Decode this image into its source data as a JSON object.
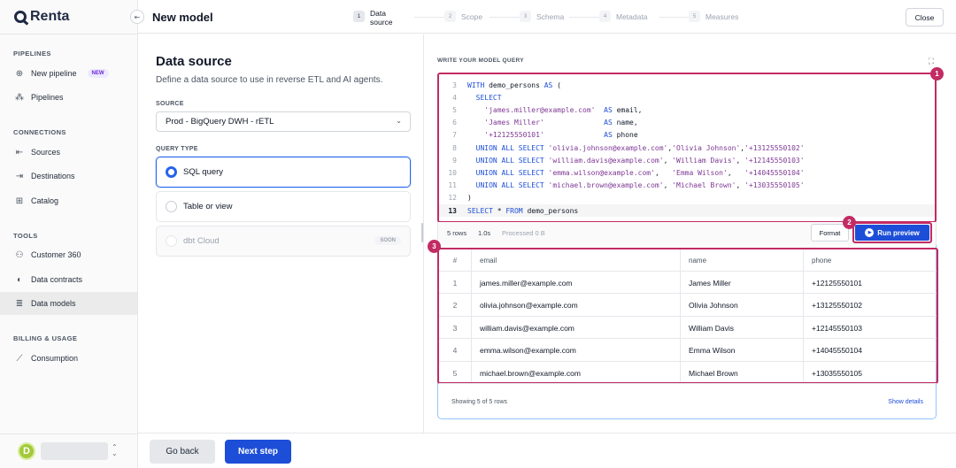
{
  "app": {
    "logo_text": "Renta",
    "page_title": "New model",
    "close_label": "Close"
  },
  "steps": [
    {
      "num": "1",
      "label_line1": "Data",
      "label_line2": "source",
      "active": true
    },
    {
      "num": "2",
      "label_line1": "Scope",
      "label_line2": ""
    },
    {
      "num": "3",
      "label_line1": "Schema",
      "label_line2": ""
    },
    {
      "num": "4",
      "label_line1": "Metadata",
      "label_line2": ""
    },
    {
      "num": "5",
      "label_line1": "Measures",
      "label_line2": ""
    }
  ],
  "sidebar": {
    "sections": {
      "pipelines": "PIPELINES",
      "connections": "CONNECTIONS",
      "tools": "TOOLS",
      "billing": "BILLING & USAGE"
    },
    "items": {
      "new_pipeline": "New pipeline",
      "new_badge": "NEW",
      "pipelines": "Pipelines",
      "sources": "Sources",
      "destinations": "Destinations",
      "catalog": "Catalog",
      "customer360": "Customer 360",
      "data_contracts": "Data contracts",
      "data_models": "Data models",
      "consumption": "Consumption"
    },
    "user_initial": "D"
  },
  "form": {
    "title": "Data source",
    "description": "Define a data source to use in reverse ETL and AI agents.",
    "source_label": "SOURCE",
    "source_value": "Prod - BigQuery DWH - rETL",
    "query_type_label": "QUERY TYPE",
    "options": {
      "sql": "SQL query",
      "table": "Table or view",
      "dbt": "dbt Cloud",
      "soon": "SOON"
    }
  },
  "query": {
    "label": "WRITE YOUR MODEL QUERY",
    "lines": [
      {
        "n": "3",
        "parts": [
          [
            "kw",
            "WITH "
          ],
          [
            "id",
            "demo_persons "
          ],
          [
            "kw",
            "AS"
          ],
          [
            "id",
            " ("
          ]
        ]
      },
      {
        "n": "4",
        "parts": [
          [
            "kw",
            "  SELECT"
          ]
        ]
      },
      {
        "n": "5",
        "parts": [
          [
            "str",
            "    'james.miller@example.com'"
          ],
          [
            "kw",
            "  AS "
          ],
          [
            "id",
            "email,"
          ]
        ]
      },
      {
        "n": "6",
        "parts": [
          [
            "str",
            "    'James Miller'"
          ],
          [
            "kw",
            "              AS "
          ],
          [
            "id",
            "name,"
          ]
        ]
      },
      {
        "n": "7",
        "parts": [
          [
            "str",
            "    '+12125550101'"
          ],
          [
            "kw",
            "              AS "
          ],
          [
            "id",
            "phone"
          ]
        ]
      },
      {
        "n": "8",
        "parts": [
          [
            "kw",
            "  UNION ALL SELECT "
          ],
          [
            "str",
            "'olivia.johnson@example.com'"
          ],
          [
            "id",
            ","
          ],
          [
            "str",
            "'Olivia Johnson'"
          ],
          [
            "id",
            ","
          ],
          [
            "str",
            "'+13125550102'"
          ]
        ]
      },
      {
        "n": "9",
        "parts": [
          [
            "kw",
            "  UNION ALL SELECT "
          ],
          [
            "str",
            "'william.davis@example.com'"
          ],
          [
            "id",
            ", "
          ],
          [
            "str",
            "'William Davis'"
          ],
          [
            "id",
            ", "
          ],
          [
            "str",
            "'+12145550103'"
          ]
        ]
      },
      {
        "n": "10",
        "parts": [
          [
            "kw",
            "  UNION ALL SELECT "
          ],
          [
            "str",
            "'emma.wilson@example.com'"
          ],
          [
            "id",
            ",   "
          ],
          [
            "str",
            "'Emma Wilson'"
          ],
          [
            "id",
            ",   "
          ],
          [
            "str",
            "'+14045550104'"
          ]
        ]
      },
      {
        "n": "11",
        "parts": [
          [
            "kw",
            "  UNION ALL SELECT "
          ],
          [
            "str",
            "'michael.brown@example.com'"
          ],
          [
            "id",
            ", "
          ],
          [
            "str",
            "'Michael Brown'"
          ],
          [
            "id",
            ", "
          ],
          [
            "str",
            "'+13035550105'"
          ]
        ]
      },
      {
        "n": "12",
        "parts": [
          [
            "id",
            ")"
          ]
        ]
      },
      {
        "n": "13",
        "parts": [
          [
            "kw",
            "SELECT "
          ],
          [
            "id",
            "* "
          ],
          [
            "kw",
            "FROM "
          ],
          [
            "id",
            "demo_persons"
          ]
        ]
      }
    ],
    "stats": {
      "rows": "5 rows",
      "time": "1.0s",
      "processed": "Processed 0 B"
    },
    "format_label": "Format",
    "run_label": "Run preview"
  },
  "results": {
    "headers": [
      "#",
      "email",
      "name",
      "phone"
    ],
    "rows": [
      [
        "1",
        "james.miller@example.com",
        "James Miller",
        "+12125550101"
      ],
      [
        "2",
        "olivia.johnson@example.com",
        "Olivia Johnson",
        "+13125550102"
      ],
      [
        "3",
        "william.davis@example.com",
        "William Davis",
        "+12145550103"
      ],
      [
        "4",
        "emma.wilson@example.com",
        "Emma Wilson",
        "+14045550104"
      ],
      [
        "5",
        "michael.brown@example.com",
        "Michael Brown",
        "+13035550105"
      ]
    ],
    "showing": "Showing 5 of 5 rows",
    "show_details": "Show details"
  },
  "markers": [
    "1",
    "2",
    "3"
  ],
  "footer": {
    "back_label": "Go back",
    "next_label": "Next step"
  },
  "colors": {
    "accent": "#1d4ed8",
    "highlight": "#c22b63"
  }
}
